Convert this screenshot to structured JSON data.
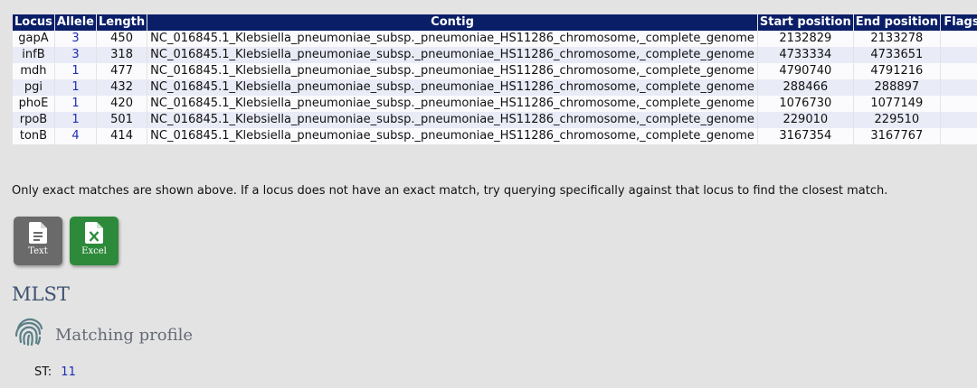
{
  "table": {
    "headers": {
      "locus": "Locus",
      "allele": "Allele",
      "length": "Length",
      "contig": "Contig",
      "start": "Start position",
      "end": "End position",
      "flags": "Flags"
    },
    "rows": [
      {
        "locus": "gapA",
        "allele": "3",
        "length": "450",
        "contig": "NC_016845.1_Klebsiella_pneumoniae_subsp._pneumoniae_HS11286_chromosome,_complete_genome",
        "start": "2132829",
        "end": "2133278",
        "flags": ""
      },
      {
        "locus": "infB",
        "allele": "3",
        "length": "318",
        "contig": "NC_016845.1_Klebsiella_pneumoniae_subsp._pneumoniae_HS11286_chromosome,_complete_genome",
        "start": "4733334",
        "end": "4733651",
        "flags": ""
      },
      {
        "locus": "mdh",
        "allele": "1",
        "length": "477",
        "contig": "NC_016845.1_Klebsiella_pneumoniae_subsp._pneumoniae_HS11286_chromosome,_complete_genome",
        "start": "4790740",
        "end": "4791216",
        "flags": ""
      },
      {
        "locus": "pgi",
        "allele": "1",
        "length": "432",
        "contig": "NC_016845.1_Klebsiella_pneumoniae_subsp._pneumoniae_HS11286_chromosome,_complete_genome",
        "start": "288466",
        "end": "288897",
        "flags": ""
      },
      {
        "locus": "phoE",
        "allele": "1",
        "length": "420",
        "contig": "NC_016845.1_Klebsiella_pneumoniae_subsp._pneumoniae_HS11286_chromosome,_complete_genome",
        "start": "1076730",
        "end": "1077149",
        "flags": ""
      },
      {
        "locus": "rpoB",
        "allele": "1",
        "length": "501",
        "contig": "NC_016845.1_Klebsiella_pneumoniae_subsp._pneumoniae_HS11286_chromosome,_complete_genome",
        "start": "229010",
        "end": "229510",
        "flags": ""
      },
      {
        "locus": "tonB",
        "allele": "4",
        "length": "414",
        "contig": "NC_016845.1_Klebsiella_pneumoniae_subsp._pneumoniae_HS11286_chromosome,_complete_genome",
        "start": "3167354",
        "end": "3167767",
        "flags": ""
      }
    ]
  },
  "note": "Only exact matches are shown above. If a locus does not have an exact match, try querying specifically against that locus to find the closest match.",
  "exports": {
    "text": {
      "label": "Text",
      "icon": "text-file-icon",
      "color": "#6a6a6a"
    },
    "excel": {
      "label": "Excel",
      "icon": "excel-file-icon",
      "color": "#2d8a3a"
    }
  },
  "mlst": {
    "heading": "MLST",
    "match_icon": "fingerprint-icon",
    "match_title": "Matching profile",
    "st_label": "ST:",
    "st_value": "11"
  },
  "colors": {
    "header_bg": "#0a1e68",
    "link": "#1d2db5",
    "page_bg": "#e3e3e3",
    "row_alt": "#e9ebf7",
    "heading": "#3e5273"
  }
}
